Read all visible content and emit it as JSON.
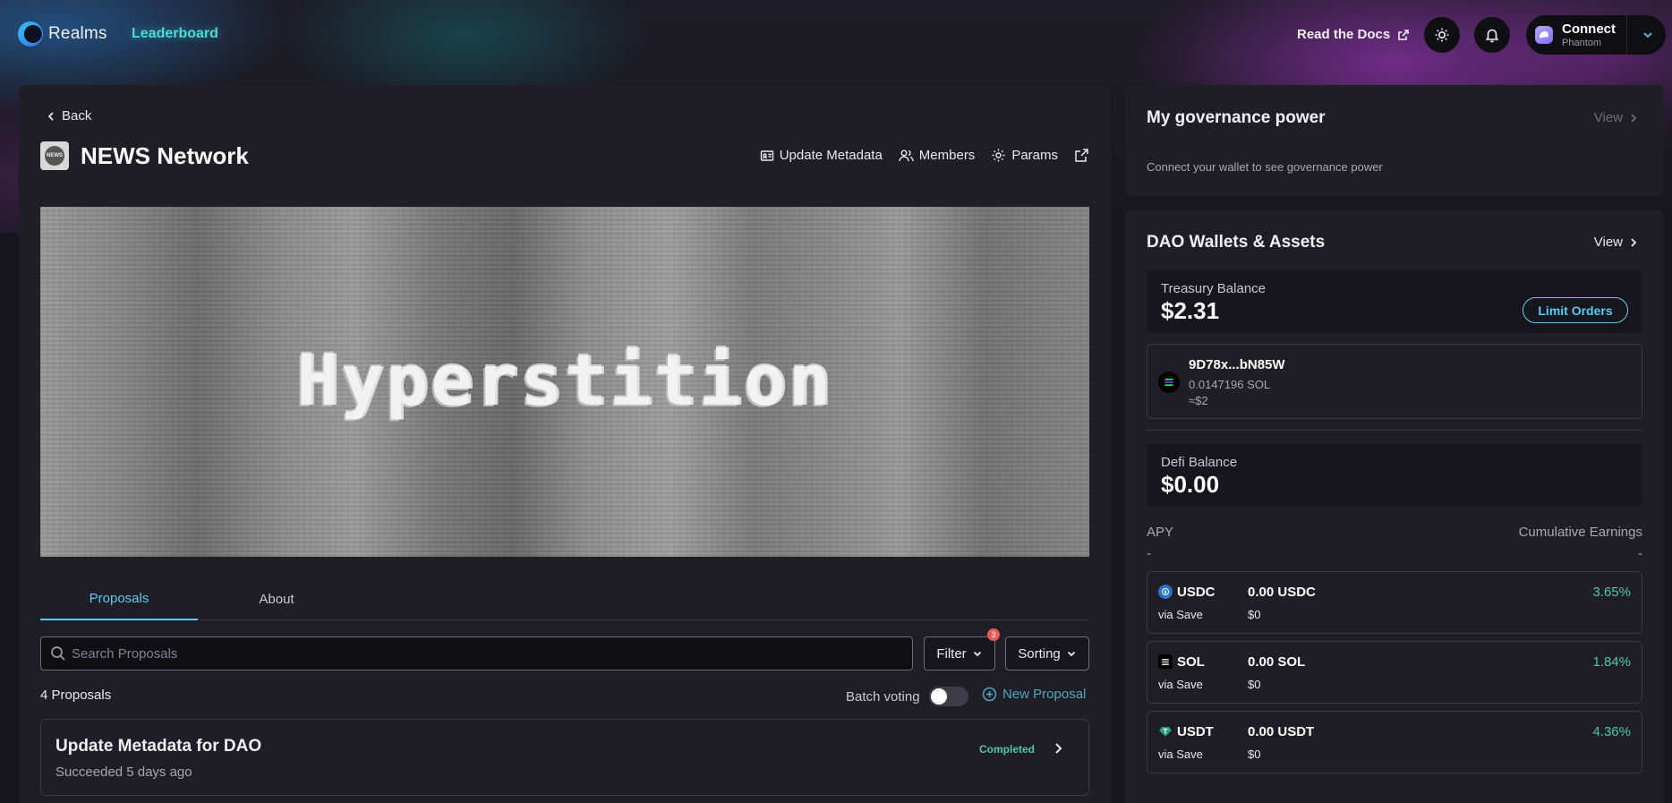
{
  "nav": {
    "logo_text": "Realms",
    "leaderboard": "Leaderboard",
    "docs": "Read the Docs",
    "connect_label": "Connect",
    "connect_sub": "Phantom"
  },
  "main": {
    "back": "Back",
    "org_name": "NEWS Network",
    "org_avatar_text": "NEWS",
    "actions": {
      "update_metadata": "Update Metadata",
      "members": "Members",
      "params": "Params"
    },
    "banner_text": "Hyperstition",
    "tabs": [
      {
        "label": "Proposals",
        "active": true
      },
      {
        "label": "About",
        "active": false
      }
    ],
    "search_placeholder": "Search Proposals",
    "filter_label": "Filter",
    "filter_badge": "3",
    "sorting_label": "Sorting",
    "proposal_count": "4 Proposals",
    "batch_voting": "Batch voting",
    "new_proposal": "New Proposal",
    "proposals": [
      {
        "title": "Update Metadata for DAO",
        "subtitle": "Succeeded 5 days ago",
        "status": "Completed"
      }
    ]
  },
  "governance": {
    "title": "My governance power",
    "view": "View",
    "desc": "Connect your wallet to see governance power"
  },
  "dao": {
    "title": "DAO Wallets & Assets",
    "view": "View",
    "treasury_label": "Treasury Balance",
    "treasury_value": "$2.31",
    "limit_orders": "Limit Orders",
    "wallet": {
      "address": "9D78x...bN85W",
      "sol": "0.0147196 SOL",
      "usd": "≈$2"
    },
    "defi_label": "Defi Balance",
    "defi_value": "$0.00",
    "apy_label": "APY",
    "apy_value": "-",
    "cumulative_label": "Cumulative Earnings",
    "cumulative_value": "-",
    "assets": [
      {
        "symbol": "USDC",
        "via": "via Save",
        "amount": "0.00 USDC",
        "usd": "$0",
        "apy": "3.65%",
        "icon": "usdc-icon",
        "color": "#2775ca"
      },
      {
        "symbol": "SOL",
        "via": "via Save",
        "amount": "0.00 SOL",
        "usd": "$0",
        "apy": "1.84%",
        "icon": "sol-icon",
        "color": "#000000"
      },
      {
        "symbol": "USDT",
        "via": "via Save",
        "amount": "0.00 USDT",
        "usd": "$0",
        "apy": "4.36%",
        "icon": "usdt-icon",
        "color": "#26a17b"
      }
    ]
  }
}
